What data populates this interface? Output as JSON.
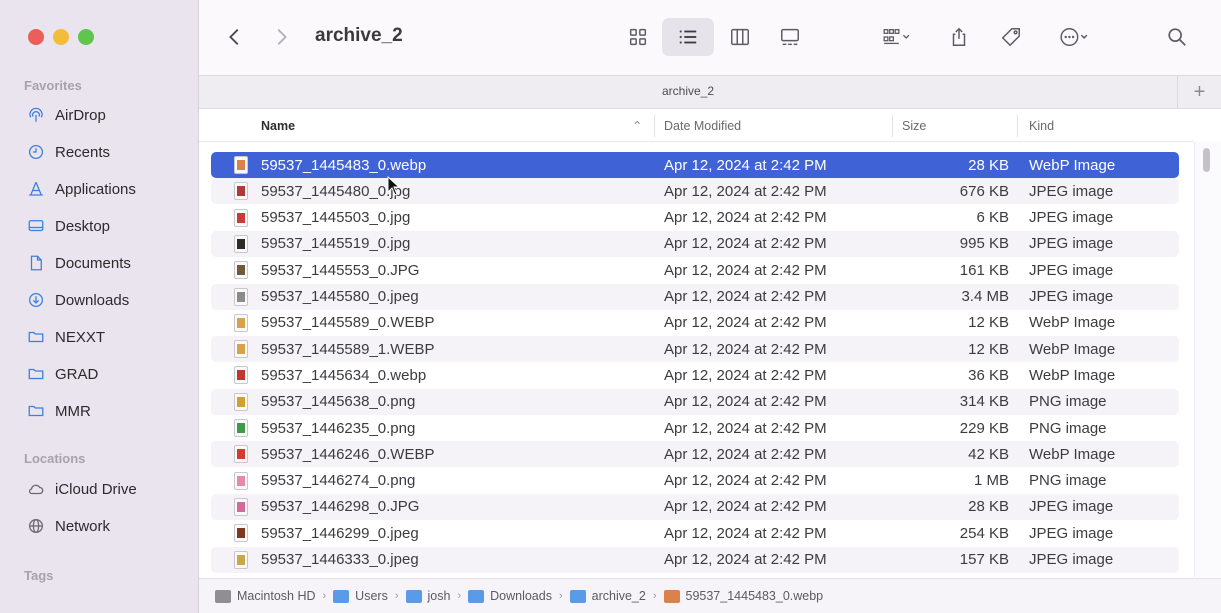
{
  "window": {
    "title": "archive_2",
    "tab_title": "archive_2"
  },
  "sidebar": {
    "favorites_heading": "Favorites",
    "locations_heading": "Locations",
    "tags_heading": "Tags",
    "favorites": [
      {
        "label": "AirDrop",
        "icon": "airdrop-icon"
      },
      {
        "label": "Recents",
        "icon": "clock-icon"
      },
      {
        "label": "Applications",
        "icon": "applications-icon"
      },
      {
        "label": "Desktop",
        "icon": "desktop-icon"
      },
      {
        "label": "Documents",
        "icon": "document-icon"
      },
      {
        "label": "Downloads",
        "icon": "download-icon"
      },
      {
        "label": "NEXXT",
        "icon": "folder-icon"
      },
      {
        "label": "GRAD",
        "icon": "folder-icon"
      },
      {
        "label": "MMR",
        "icon": "folder-icon"
      }
    ],
    "locations": [
      {
        "label": "iCloud Drive",
        "icon": "cloud-icon"
      },
      {
        "label": "Network",
        "icon": "network-icon"
      }
    ]
  },
  "columns": {
    "name": "Name",
    "date": "Date Modified",
    "size": "Size",
    "kind": "Kind"
  },
  "files": [
    {
      "name": "59537_1445483_0.webp",
      "date": "Apr 12, 2024 at 2:42 PM",
      "size": "28 KB",
      "kind": "WebP Image",
      "selected": true,
      "thumb": "#d9834a"
    },
    {
      "name": "59537_1445480_0.jpg",
      "date": "Apr 12, 2024 at 2:42 PM",
      "size": "676 KB",
      "kind": "JPEG image",
      "thumb": "#b4373a"
    },
    {
      "name": "59537_1445503_0.jpg",
      "date": "Apr 12, 2024 at 2:42 PM",
      "size": "6 KB",
      "kind": "JPEG image",
      "thumb": "#c93b3b"
    },
    {
      "name": "59537_1445519_0.jpg",
      "date": "Apr 12, 2024 at 2:42 PM",
      "size": "995 KB",
      "kind": "JPEG image",
      "thumb": "#2e2a26"
    },
    {
      "name": "59537_1445553_0.JPG",
      "date": "Apr 12, 2024 at 2:42 PM",
      "size": "161 KB",
      "kind": "JPEG image",
      "thumb": "#6e5a3c"
    },
    {
      "name": "59537_1445580_0.jpeg",
      "date": "Apr 12, 2024 at 2:42 PM",
      "size": "3.4 MB",
      "kind": "JPEG image",
      "thumb": "#8b8b8b"
    },
    {
      "name": "59537_1445589_0.WEBP",
      "date": "Apr 12, 2024 at 2:42 PM",
      "size": "12 KB",
      "kind": "WebP Image",
      "thumb": "#d8a24a"
    },
    {
      "name": "59537_1445589_1.WEBP",
      "date": "Apr 12, 2024 at 2:42 PM",
      "size": "12 KB",
      "kind": "WebP Image",
      "thumb": "#d8a24a"
    },
    {
      "name": "59537_1445634_0.webp",
      "date": "Apr 12, 2024 at 2:42 PM",
      "size": "36 KB",
      "kind": "WebP Image",
      "thumb": "#c2362f"
    },
    {
      "name": "59537_1445638_0.png",
      "date": "Apr 12, 2024 at 2:42 PM",
      "size": "314 KB",
      "kind": "PNG image",
      "thumb": "#d0a030"
    },
    {
      "name": "59537_1446235_0.png",
      "date": "Apr 12, 2024 at 2:42 PM",
      "size": "229 KB",
      "kind": "PNG image",
      "thumb": "#3f9a4a"
    },
    {
      "name": "59537_1446246_0.WEBP",
      "date": "Apr 12, 2024 at 2:42 PM",
      "size": "42 KB",
      "kind": "WebP Image",
      "thumb": "#d23c2c"
    },
    {
      "name": "59537_1446274_0.png",
      "date": "Apr 12, 2024 at 2:42 PM",
      "size": "1 MB",
      "kind": "PNG image",
      "thumb": "#e48aa8"
    },
    {
      "name": "59537_1446298_0.JPG",
      "date": "Apr 12, 2024 at 2:42 PM",
      "size": "28 KB",
      "kind": "JPEG image",
      "thumb": "#d46a9a"
    },
    {
      "name": "59537_1446299_0.jpeg",
      "date": "Apr 12, 2024 at 2:42 PM",
      "size": "254 KB",
      "kind": "JPEG image",
      "thumb": "#7a3a20"
    },
    {
      "name": "59537_1446333_0.jpeg",
      "date": "Apr 12, 2024 at 2:42 PM",
      "size": "157 KB",
      "kind": "JPEG image",
      "thumb": "#c9a84a"
    }
  ],
  "pathbar": [
    {
      "label": "Macintosh HD",
      "color": "#8e8e93"
    },
    {
      "label": "Users",
      "color": "#5a9be8"
    },
    {
      "label": "josh",
      "color": "#5a9be8"
    },
    {
      "label": "Downloads",
      "color": "#5a9be8"
    },
    {
      "label": "archive_2",
      "color": "#5a9be8"
    },
    {
      "label": "59537_1445483_0.webp",
      "color": "#d9834a"
    }
  ],
  "colors": {
    "selection": "#3f63d6",
    "sidebar_bg": "#e9e4ed",
    "accent_icon": "#3b7fe0"
  }
}
